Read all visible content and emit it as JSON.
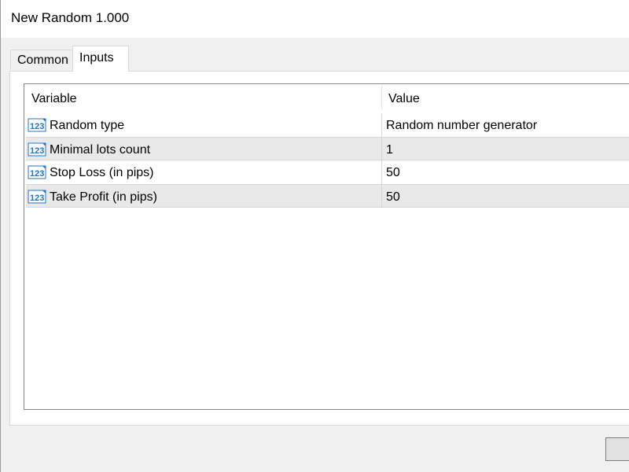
{
  "window": {
    "title": "New Random 1.000"
  },
  "tabs": [
    {
      "label": "Common",
      "active": false
    },
    {
      "label": "Inputs",
      "active": true
    }
  ],
  "table": {
    "columns": [
      "Variable",
      "Value"
    ],
    "rows": [
      {
        "icon": "number-123-icon",
        "variable": "Random type",
        "value": "Random number generator"
      },
      {
        "icon": "number-123-icon",
        "variable": "Minimal lots count",
        "value": "1"
      },
      {
        "icon": "number-123-icon",
        "variable": "Stop Loss (in pips)",
        "value": "50"
      },
      {
        "icon": "number-123-icon",
        "variable": "Take Profit (in pips)",
        "value": "50"
      }
    ]
  },
  "colors": {
    "icon_blue": "#1e73d2",
    "row_alt": "#e9e9e9"
  }
}
